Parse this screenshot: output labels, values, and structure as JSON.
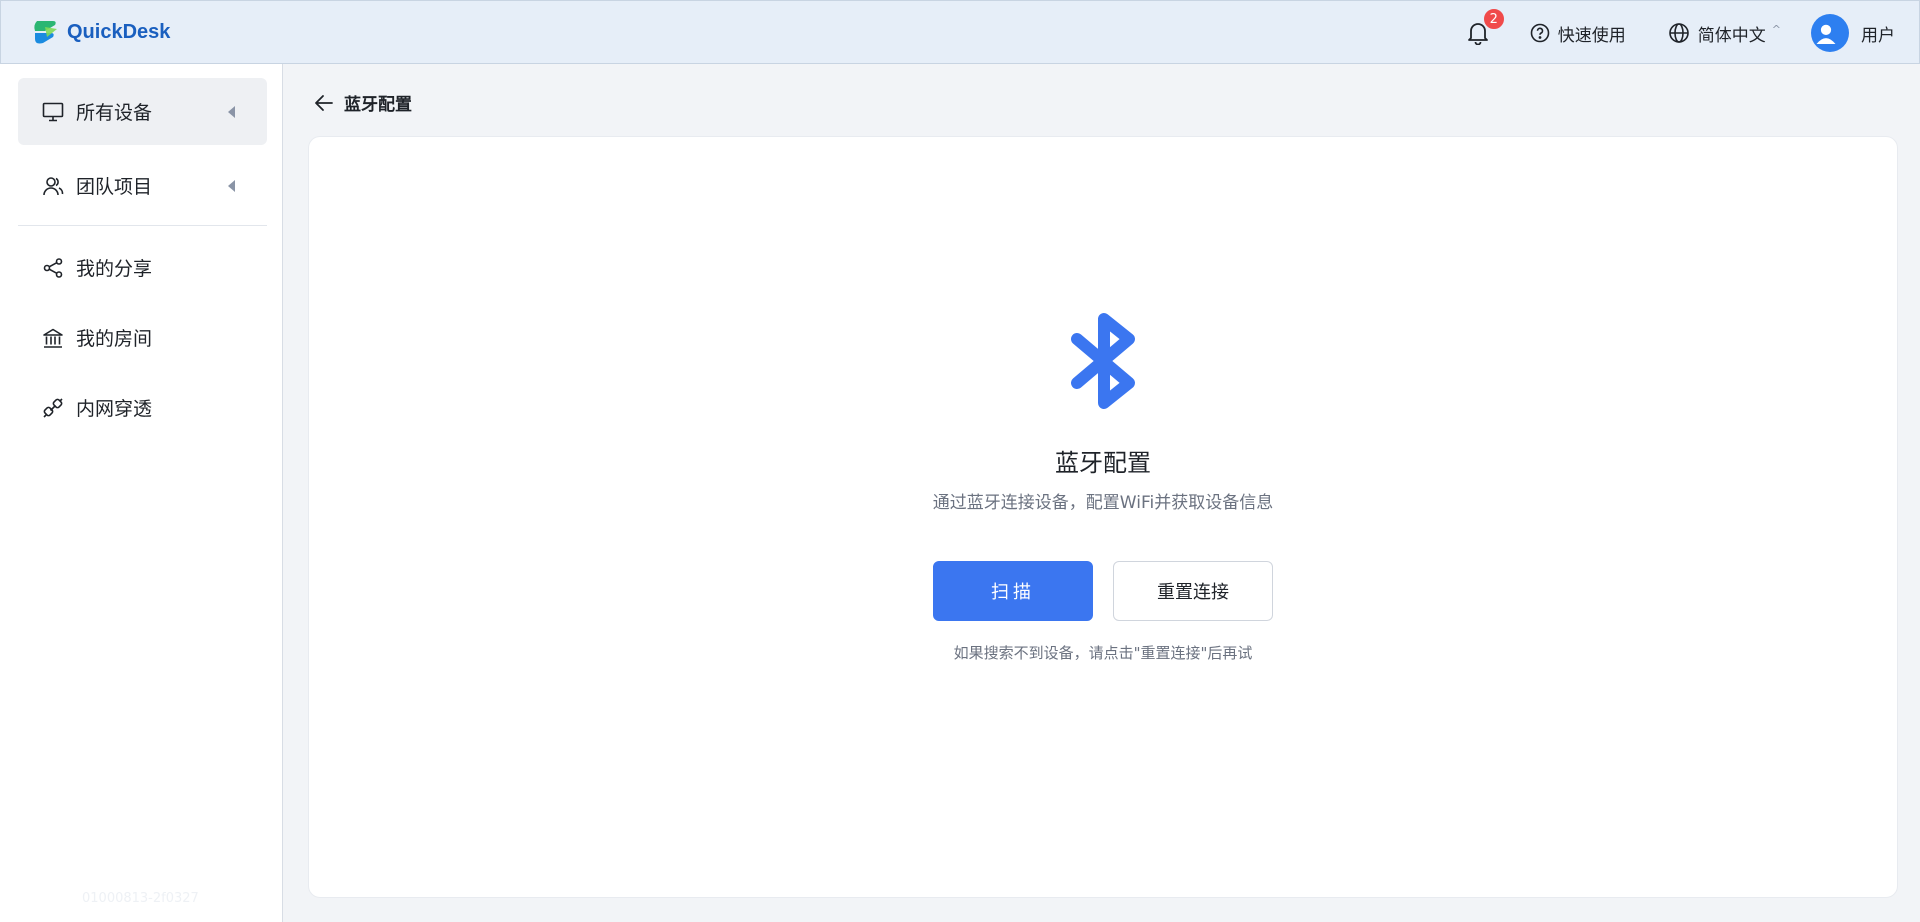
{
  "header": {
    "logo_text": "QuickDesk",
    "notification_count": "2",
    "help_label": "快速使用",
    "language_label": "简体中文",
    "language_caret": "^",
    "user_label": "用户"
  },
  "sidebar": {
    "items": [
      {
        "label": "所有设备",
        "icon": "monitor-icon",
        "active": true,
        "expandable": true
      },
      {
        "label": "团队项目",
        "icon": "team-icon",
        "active": false,
        "expandable": true
      },
      {
        "label": "我的分享",
        "icon": "share-icon",
        "active": false
      },
      {
        "label": "我的房间",
        "icon": "building-icon",
        "active": false
      },
      {
        "label": "内网穿透",
        "icon": "link-icon",
        "active": false
      }
    ],
    "version": "01000813-2f0327"
  },
  "main": {
    "breadcrumb": "蓝牙配置",
    "title": "蓝牙配置",
    "description": "通过蓝牙连接设备，配置WiFi并获取设备信息",
    "scan_button": "扫描",
    "reset_button": "重置连接",
    "hint": "如果搜索不到设备，请点击\"重置连接\"后再试"
  },
  "colors": {
    "accent": "#3b76f0",
    "badge": "#f04a4a",
    "header_bg": "#e6eef8"
  }
}
